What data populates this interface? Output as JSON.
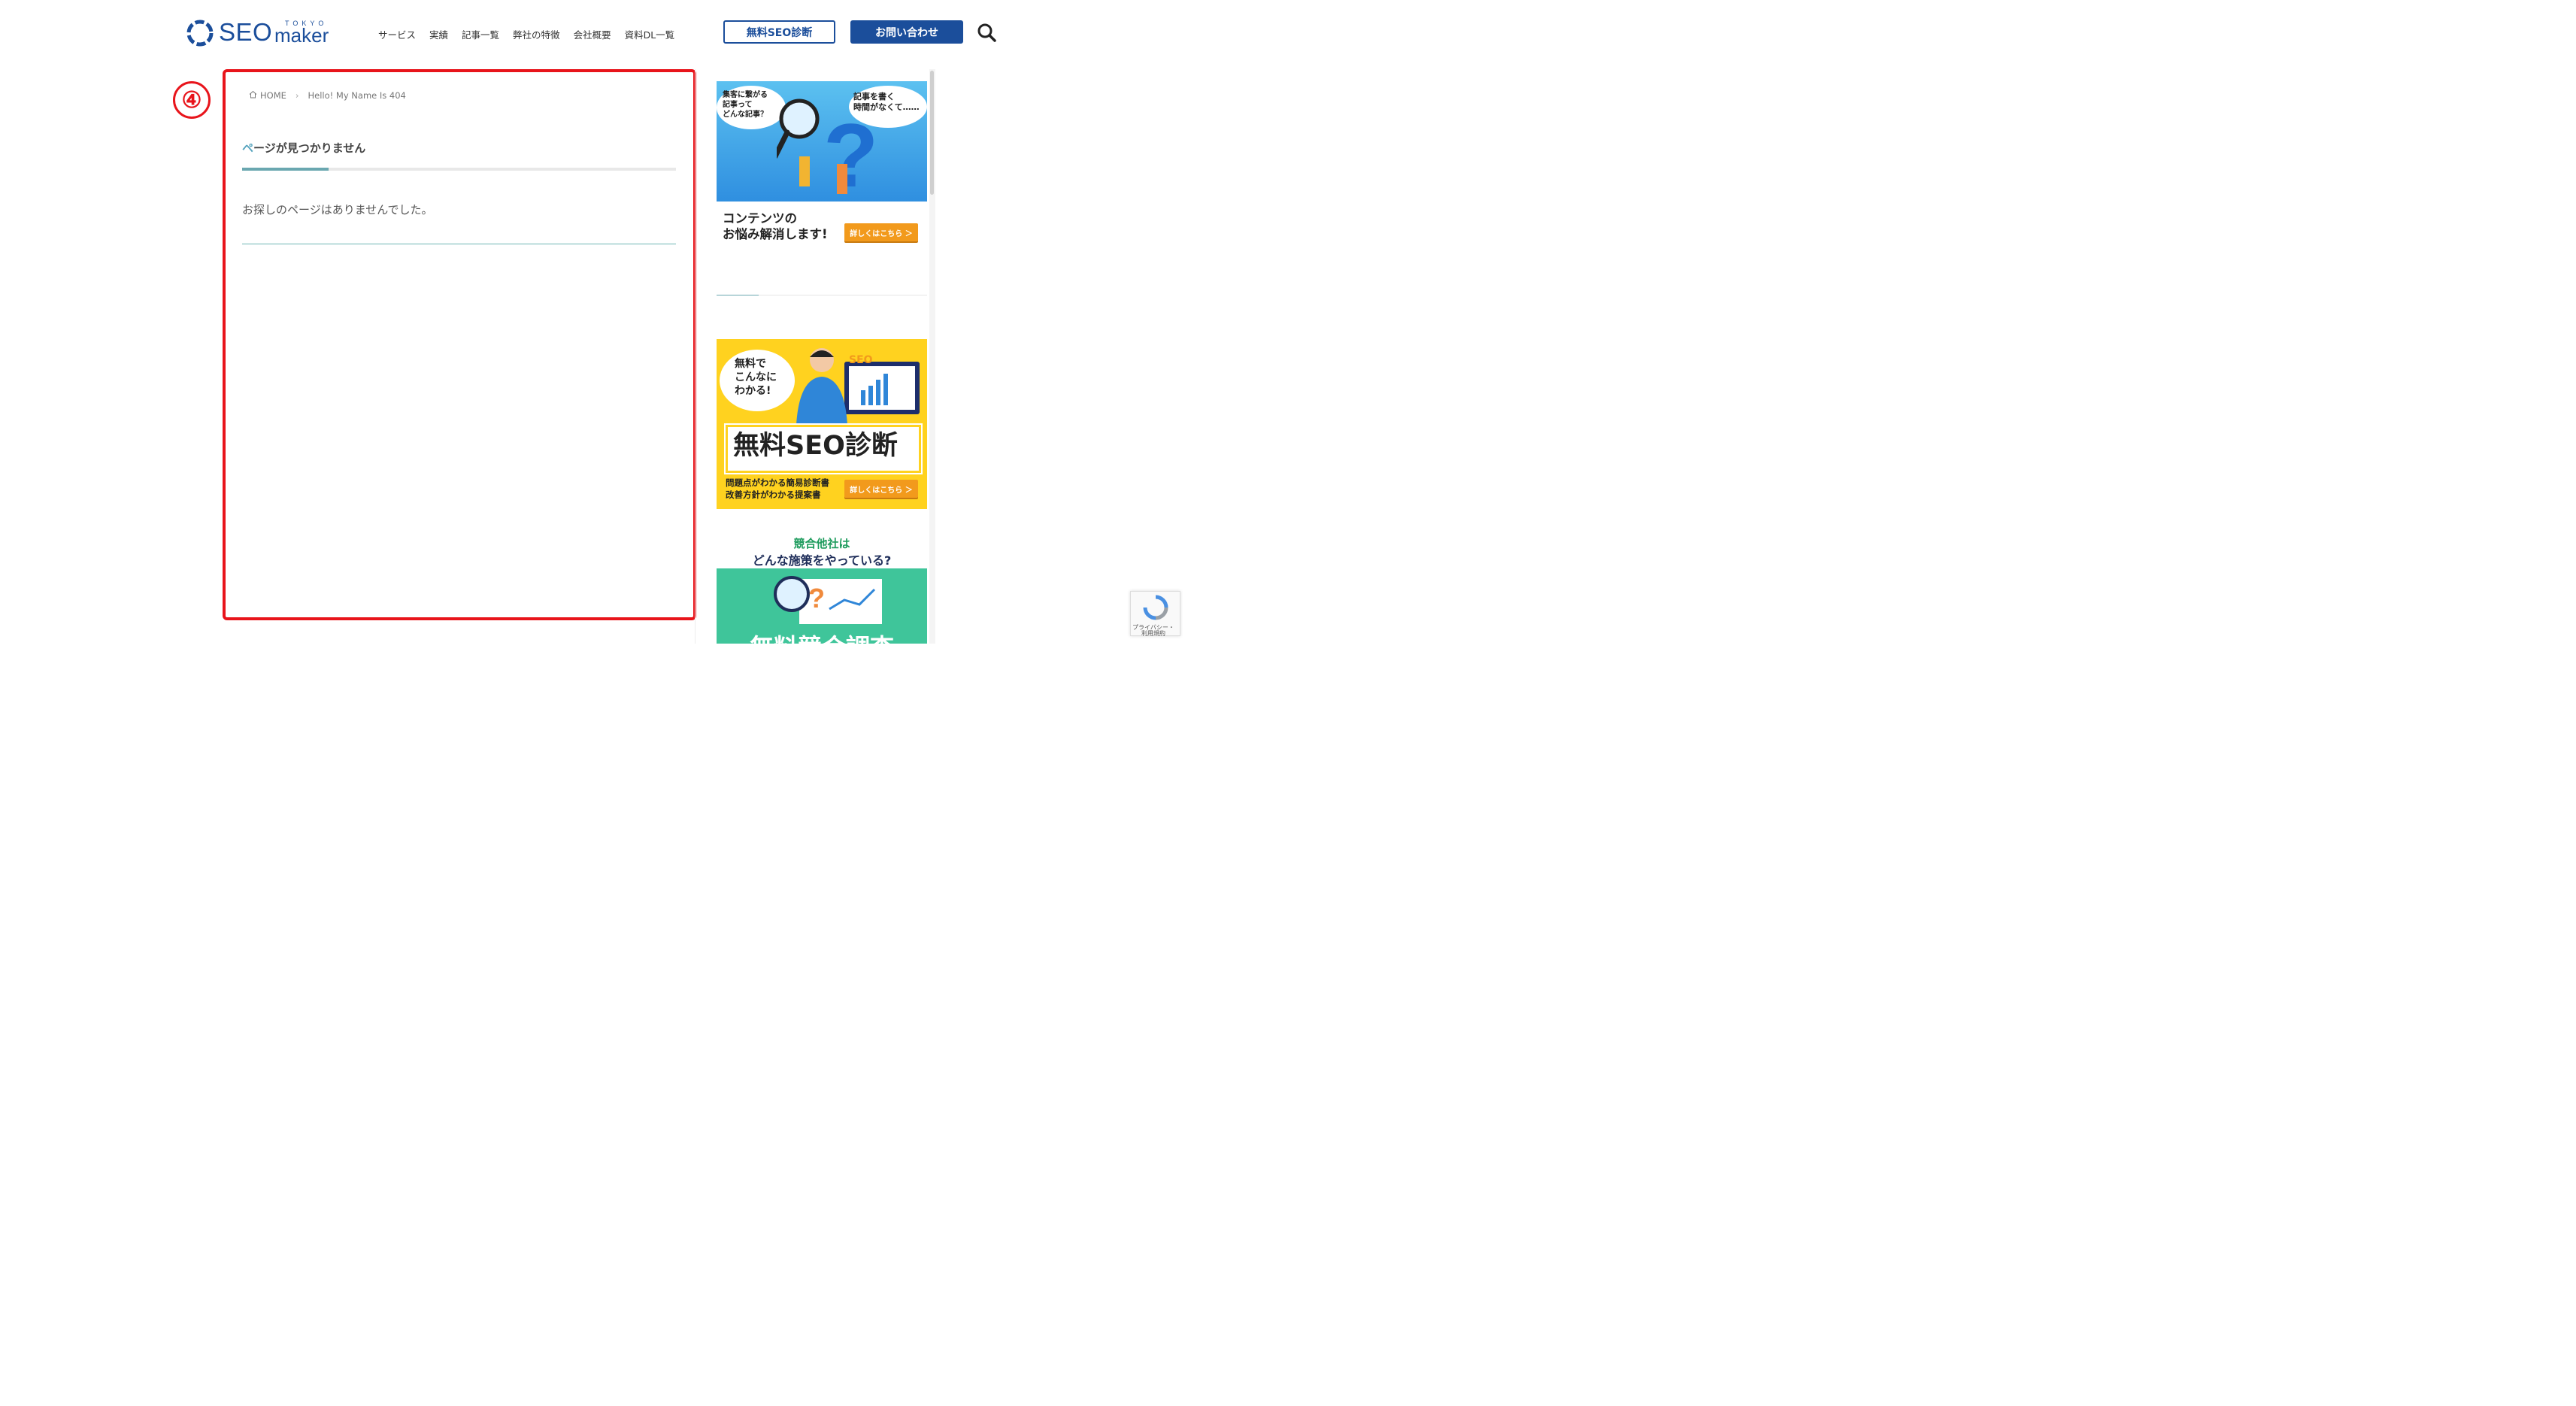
{
  "header": {
    "logo_word": "SEO",
    "logo_tokyo": "TOKYO",
    "logo_maker": "maker",
    "nav": [
      "サービス",
      "実績",
      "記事一覧",
      "弊社の特徴",
      "会社概要",
      "資料DL一覧"
    ],
    "btn_free": "無料SEO診断",
    "btn_contact": "お問い合わせ"
  },
  "annotation": {
    "number": "④"
  },
  "breadcrumb": {
    "home": "HOME",
    "current": "Hello! My Name Is 404"
  },
  "main": {
    "title_first": "ペ",
    "title_rest": "ージが見つかりません",
    "message": "お探しのページはありませんでした。"
  },
  "sidebar": {
    "banner1": {
      "bubble_left": [
        "集客に繋がる",
        "記事って",
        "どんな記事？"
      ],
      "bubble_right": [
        "記事を書く",
        "時間がなくて……"
      ],
      "caption": [
        "コンテンツの",
        "お悩み解消します!"
      ],
      "button": "詳しくはこちら ＞"
    },
    "banner2": {
      "bubble": [
        "無料で",
        "こんなに",
        "わかる!"
      ],
      "tag": "SEO",
      "headline": "無料SEO診断",
      "sub": [
        "問題点がわかる簡易診断書",
        "改善方針がわかる提案書"
      ],
      "button": "詳しくはこちら ＞"
    },
    "banner3": {
      "heading1": "競合他社は",
      "heading2": "どんな施策をやっている?",
      "bottom": "無料競合調査"
    }
  },
  "recaptcha": {
    "privacy": "プライバシー・",
    "terms": "利用規約"
  },
  "colors": {
    "brand": "#1b4e9b",
    "accent": "#6aa7b0",
    "annotation": "#e8141b"
  }
}
